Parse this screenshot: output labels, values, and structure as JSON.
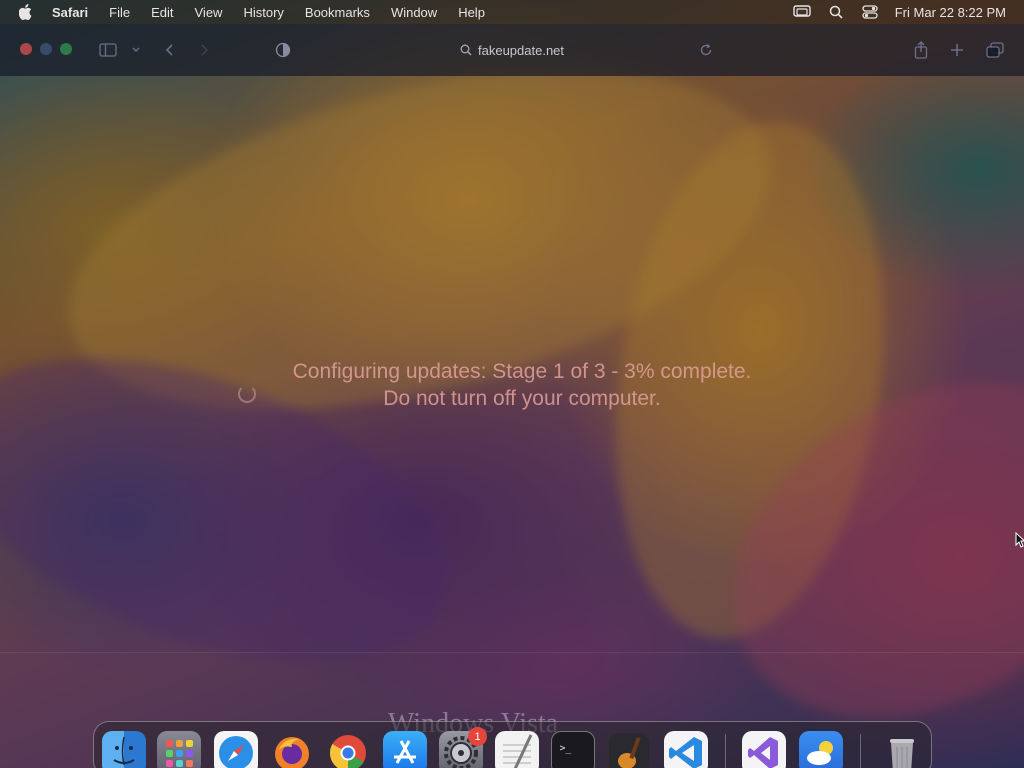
{
  "menubar": {
    "app_name": "Safari",
    "items": [
      "File",
      "Edit",
      "View",
      "History",
      "Bookmarks",
      "Window",
      "Help"
    ],
    "clock": "Fri Mar 22  8:22 PM",
    "status_icons": [
      "screen-mirroring-icon",
      "spotlight-search-icon",
      "control-center-icon"
    ]
  },
  "browser": {
    "url": "fakeupdate.net"
  },
  "page": {
    "line1": "Configuring updates: Stage 1 of 3 - 3% complete.",
    "line2": "Do not turn off your computer.",
    "background_text": "Windows Vista"
  },
  "dock": {
    "apps": [
      "Finder",
      "Launchpad",
      "Safari",
      "Firefox",
      "Google Chrome",
      "App Store",
      "System Settings",
      "TextEdit",
      "Terminal",
      "GarageBand",
      "Visual Studio Code",
      "Visual Studio",
      "Weather",
      "Trash"
    ],
    "settings_badge": "1"
  },
  "colors": {
    "close": "#a9474a",
    "minimize": "#3b4a6a",
    "maximize": "#2f7a4a",
    "message": "#e0a09a",
    "badge": "#e5453a"
  }
}
